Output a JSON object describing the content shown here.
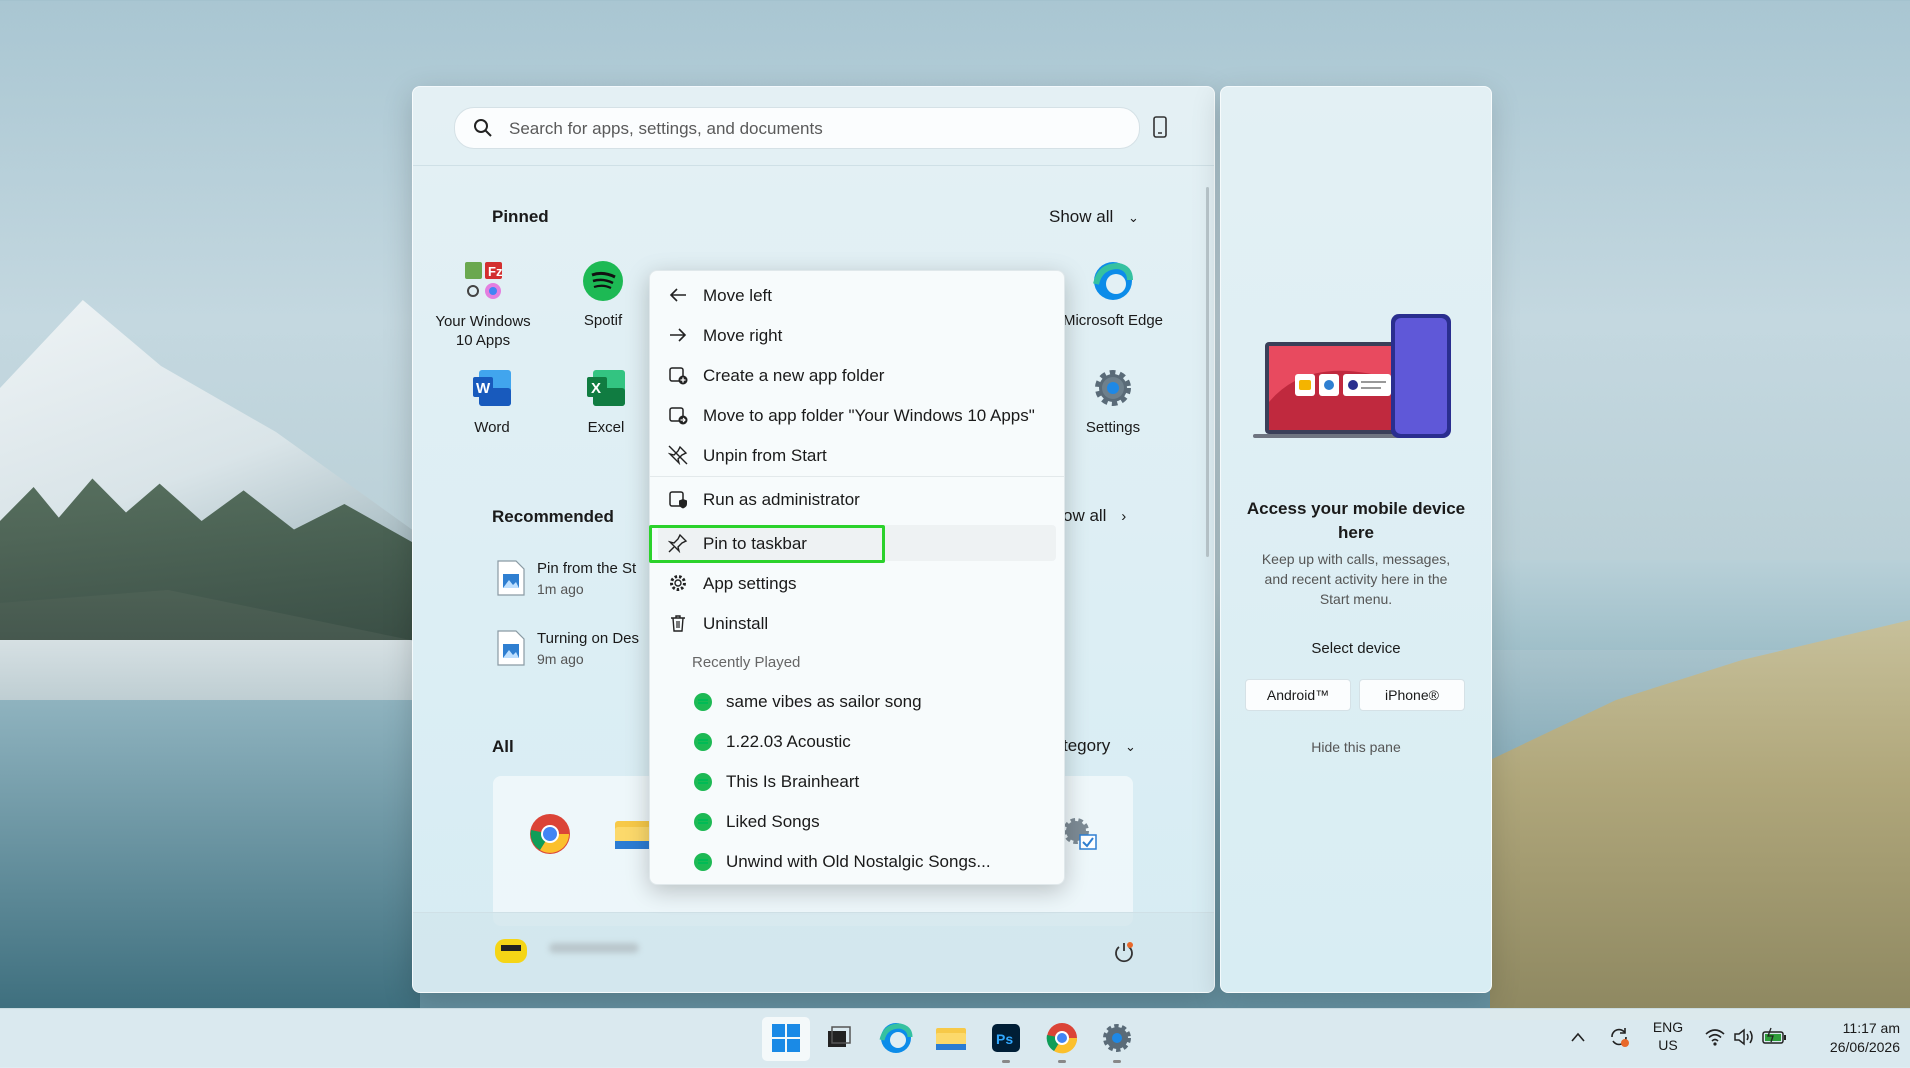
{
  "search": {
    "placeholder": "Search for apps, settings, and documents"
  },
  "pinned": {
    "title": "Pinned",
    "show_all": "Show all",
    "apps": [
      {
        "label": "Your Windows 10 Apps",
        "icon": "app-folder-icon"
      },
      {
        "label": "Spotif",
        "icon": "spotify-icon"
      },
      {
        "label": "Microsoft Edge",
        "icon": "edge-icon"
      },
      {
        "label": "Word",
        "icon": "word-icon"
      },
      {
        "label": "Excel",
        "icon": "excel-icon"
      },
      {
        "label": "Settings",
        "icon": "settings-gear-icon"
      }
    ]
  },
  "recommended": {
    "title": "Recommended",
    "show_all": "ow all",
    "items": [
      {
        "name": "Pin from the St",
        "time": "1m ago"
      },
      {
        "name": "Turning on Des",
        "time": "9m ago"
      }
    ]
  },
  "all": {
    "title": "All",
    "view": "tegory"
  },
  "context_menu": {
    "items": [
      {
        "label": "Move left",
        "icon": "arrow-left-icon"
      },
      {
        "label": "Move right",
        "icon": "arrow-right-icon"
      },
      {
        "label": "Create a new app folder",
        "icon": "new-folder-icon"
      },
      {
        "label": "Move to app folder \"Your Windows 10 Apps\"",
        "icon": "move-folder-icon"
      },
      {
        "label": "Unpin from Start",
        "icon": "unpin-icon"
      },
      {
        "label": "Run as administrator",
        "icon": "shield-icon"
      },
      {
        "label": "Pin to taskbar",
        "icon": "pin-icon"
      },
      {
        "label": "App settings",
        "icon": "gear-icon"
      },
      {
        "label": "Uninstall",
        "icon": "trash-icon"
      }
    ],
    "recent_header": "Recently Played",
    "recent": [
      "same vibes as sailor song",
      "1.22.03 Acoustic",
      "This Is Brainheart",
      "Liked Songs",
      "Unwind with Old Nostalgic Songs..."
    ]
  },
  "side_pane": {
    "title": "Access your mobile device here",
    "desc": "Keep up with calls, messages, and recent activity here in the Start menu.",
    "select": "Select device",
    "android": "Android™",
    "iphone": "iPhone®",
    "hide": "Hide this pane"
  },
  "taskbar": {
    "lang1": "ENG",
    "lang2": "US",
    "time": "11:17 am",
    "date": "26/06/2026"
  },
  "colors": {
    "accent": "#0078d4",
    "highlight": "#2bd22b",
    "spotify": "#1db954"
  }
}
